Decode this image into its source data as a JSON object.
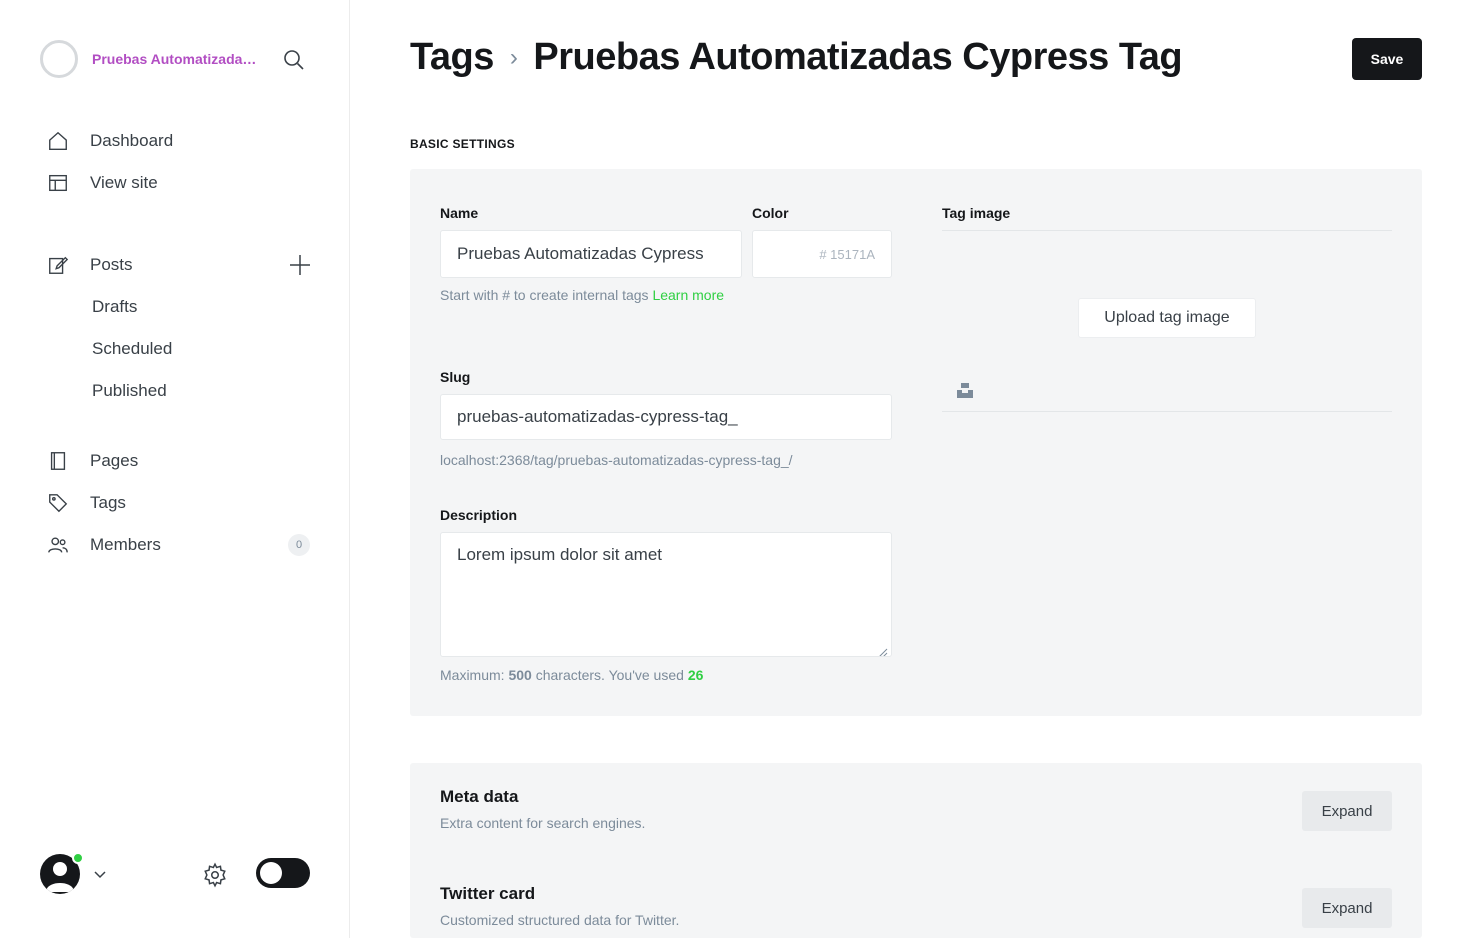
{
  "sidebar": {
    "brand_title": "Pruebas Automatizadas Cypress",
    "nav": {
      "dashboard": "Dashboard",
      "view_site": "View site",
      "posts": "Posts",
      "drafts": "Drafts",
      "scheduled": "Scheduled",
      "published": "Published",
      "pages": "Pages",
      "tags": "Tags",
      "members": "Members",
      "members_count": "0"
    }
  },
  "header": {
    "breadcrumb_parent": "Tags",
    "breadcrumb_separator": "›",
    "title": "Pruebas Automatizadas Cypress Tag",
    "save_label": "Save"
  },
  "basic_settings": {
    "section_label": "BASIC SETTINGS",
    "name_label": "Name",
    "name_value": "Pruebas Automatizadas Cypress",
    "color_label": "Color",
    "color_value": "# 15171A",
    "name_hint": "Start with # to create internal tags",
    "name_hint_link": "Learn more",
    "slug_label": "Slug",
    "slug_value": "pruebas-automatizadas-cypress-tag_",
    "slug_url": "localhost:2368/tag/pruebas-automatizadas-cypress-tag_/",
    "description_label": "Description",
    "description_value": "Lorem ipsum dolor sit amet",
    "description_hint_prefix": "Maximum:",
    "description_max": "500",
    "description_hint_middle": "characters. You've used",
    "description_used": "26",
    "tag_image_label": "Tag image",
    "upload_label": "Upload tag image"
  },
  "meta_sections": [
    {
      "title": "Meta data",
      "description": "Extra content for search engines.",
      "button": "Expand"
    },
    {
      "title": "Twitter card",
      "description": "Customized structured data for Twitter.",
      "button": "Expand"
    }
  ],
  "colors": {
    "accent_green": "#30cf43",
    "brand_purple": "#b24ec3",
    "dark": "#15171a"
  }
}
